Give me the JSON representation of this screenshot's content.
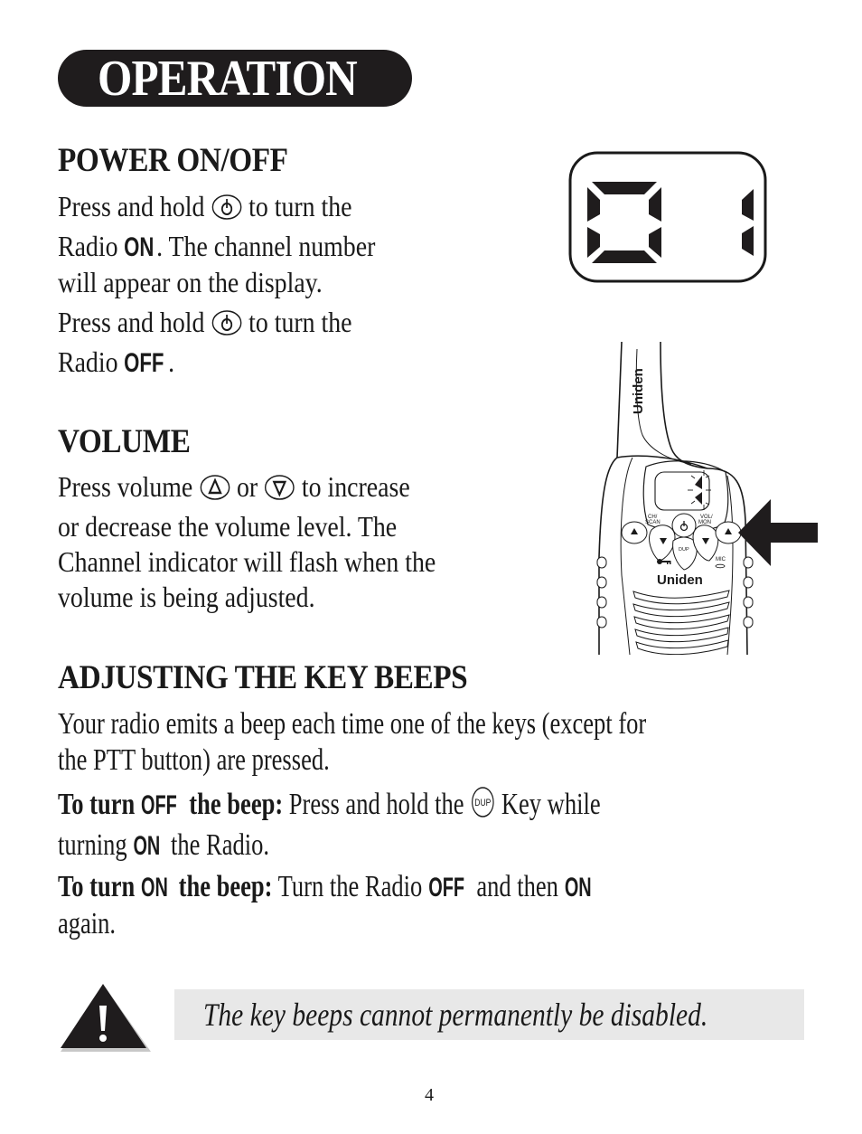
{
  "header": {
    "title": "OPERATION"
  },
  "power": {
    "heading": "POWER ON/OFF",
    "line1_a": "Press and hold",
    "line1_b": "to turn the",
    "line2_a": "Radio",
    "line2_on": "ON",
    "line2_b": ". The channel number",
    "line3": "will appear on the display.",
    "line4_a": "Press and hold",
    "line4_b": "to turn the",
    "line5_a": "Radio",
    "line5_off": "OFF",
    "line5_b": "."
  },
  "display_illustration": {
    "channel_digits": "01",
    "icon": "lcd-display"
  },
  "volume": {
    "heading": "VOLUME",
    "line1_a": "Press volume",
    "line1_or": "or",
    "line1_b": "to increase",
    "line2": "or decrease the volume level. The",
    "line3": "Channel indicator will flash when the",
    "line4": "volume is being adjusted."
  },
  "radio_illustration": {
    "brand_antenna": "Uniden",
    "brand_front": "Uniden",
    "label_ch_scan": "CH/\nSCAN",
    "label_ch": "CH/",
    "label_scan": "SCAN",
    "label_vol": "VOL/",
    "label_mon": "MON",
    "label_dup": "DUP",
    "label_mic": "MIC"
  },
  "key_beeps": {
    "heading": "ADJUSTING THE KEY BEEPS",
    "intro1": "Your radio emits a beep each time one of the keys (except for",
    "intro2": "the PTT button) are pressed.",
    "off_label_a": "To turn",
    "off_label_off": "OFF",
    "off_label_b": "the beep:",
    "off_text_a": "Press and hold the",
    "dup_key": "DUP",
    "off_text_b": "Key while",
    "off_line2_a": "turning",
    "off_line2_on": "ON",
    "off_line2_b": "the Radio.",
    "on_label_a": "To turn",
    "on_label_on": "ON",
    "on_label_b": "the beep:",
    "on_text_a": "Turn the Radio",
    "on_text_off": "OFF",
    "on_text_b": "and then",
    "on_text_on": "ON",
    "on_line2": "again."
  },
  "note": {
    "icon": "warning-icon",
    "text": "The key beeps cannot permanently be disabled."
  },
  "footer": {
    "page_number": "4"
  }
}
